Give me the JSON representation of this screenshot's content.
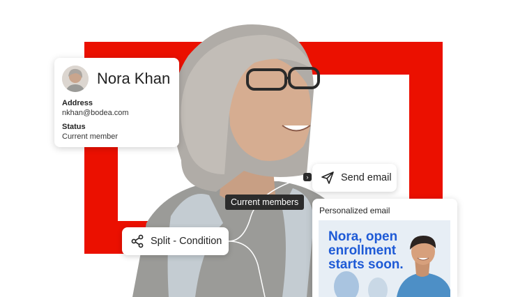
{
  "profile": {
    "name": "Nora Khan",
    "address_label": "Address",
    "address_value": "nkhan@bodea.com",
    "status_label": "Status",
    "status_value": "Current member"
  },
  "send_email": {
    "label": "Send email",
    "icon": "paper-plane-icon"
  },
  "audience_tag": {
    "label": "Current members"
  },
  "split": {
    "label": "Split - Condition",
    "icon": "share-icon"
  },
  "email_preview": {
    "title": "Personalized email",
    "headline_lines": [
      "Nora, open",
      "enrollment",
      "starts soon."
    ]
  },
  "colors": {
    "brand_red": "#eb1000",
    "headline_blue": "#1e5ad6"
  }
}
